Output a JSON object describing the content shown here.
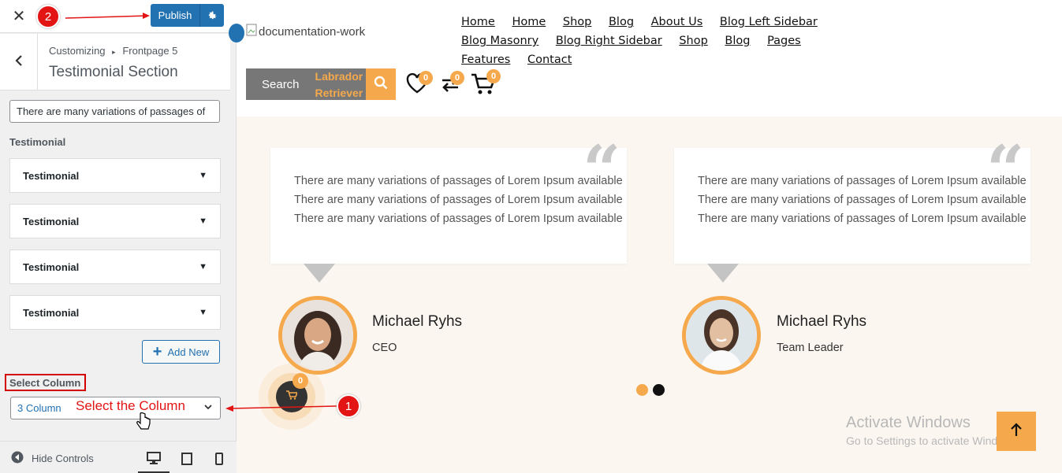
{
  "customizer": {
    "publish_label": "Publish",
    "crumb_prefix": "Customizing",
    "crumb_section": "Frontpage 5",
    "section_title": "Testimonial Section",
    "text_field_value": "There are many variations of passages of",
    "testimonial_heading": "Testimonial",
    "repeater_items": [
      "Testimonial",
      "Testimonial",
      "Testimonial",
      "Testimonial"
    ],
    "add_new_label": "Add New",
    "select_column_label": "Select Column",
    "select_column_value": "3 Column",
    "hide_controls_label": "Hide Controls"
  },
  "annotations": {
    "step1": "1",
    "step2": "2",
    "select_hint": "Select the Column",
    "color": "#e31414"
  },
  "site": {
    "logo_alt": "documentation-work",
    "nav": [
      "Home",
      "Home",
      "Shop",
      "Blog",
      "About Us",
      "Blog Left Sidebar",
      "Blog Masonry",
      "Blog Right Sidebar",
      "Shop",
      "Blog",
      "Pages",
      "Features",
      "Contact"
    ],
    "search_label": "Search",
    "search_category": "Labrador Retriever",
    "wishlist_count": "0",
    "compare_count": "0",
    "cart_count": "0",
    "floating_cart_count": "0",
    "accent_color": "#f5a94c"
  },
  "testimonials": [
    {
      "lines": [
        "There are many variations of passages of Lorem Ipsum available",
        "There are many variations of passages of Lorem Ipsum available",
        "There are many variations of passages of Lorem Ipsum available"
      ],
      "name": "Michael Ryhs",
      "role": "CEO"
    },
    {
      "lines": [
        "There are many variations of passages of Lorem Ipsum available",
        "There are many variations of passages of Lorem Ipsum available",
        "There are many variations of passages of Lorem Ipsum available"
      ],
      "name": "Michael Ryhs",
      "role": "Team Leader"
    }
  ],
  "carousel": {
    "active_index": 0,
    "count": 2
  },
  "watermark": {
    "line1": "Activate Windows",
    "line2": "Go to Settings to activate Windows."
  }
}
